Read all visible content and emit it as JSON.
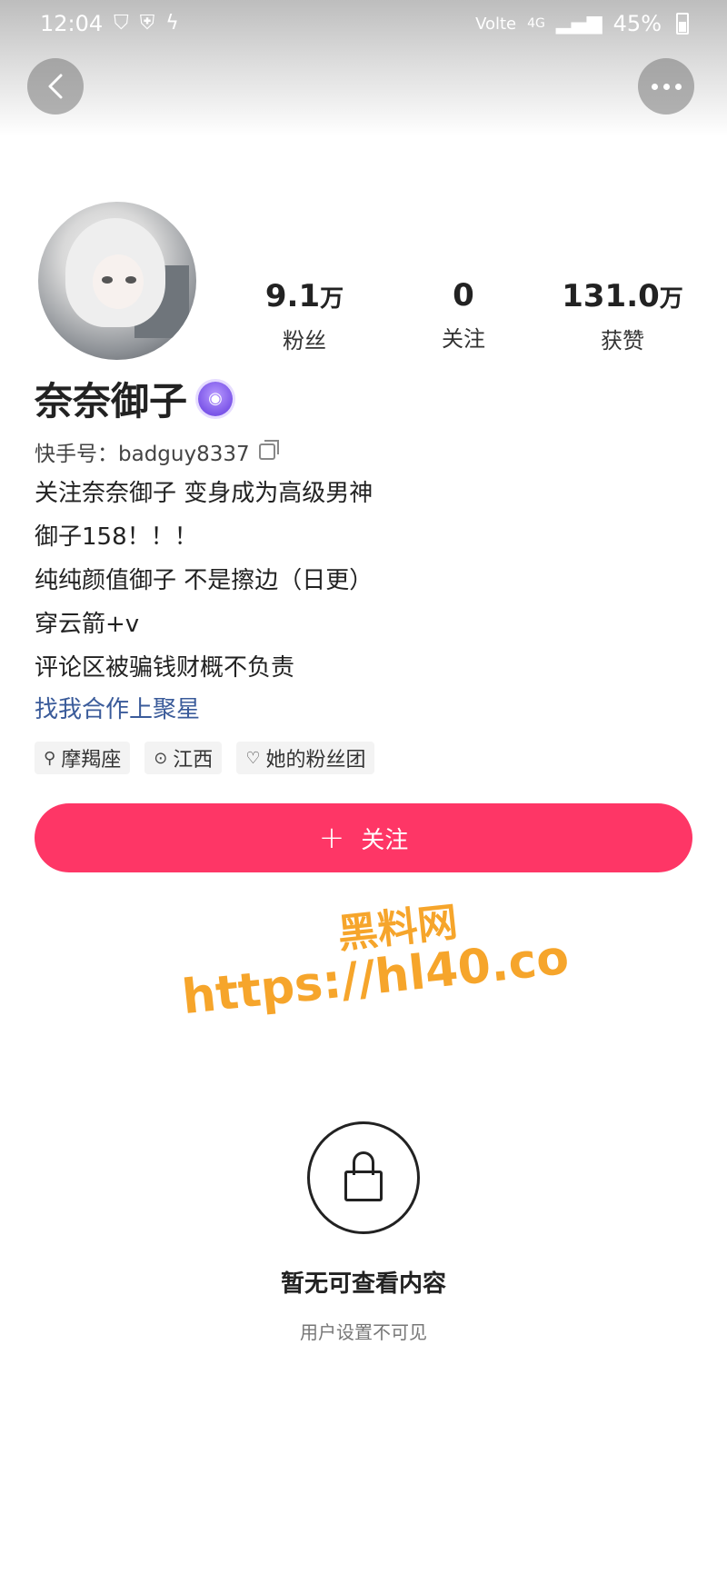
{
  "status_bar": {
    "time": "12:04",
    "left_icons": [
      "shield-check-icon",
      "shield-icon",
      "bolt-icon"
    ],
    "network": "Volte",
    "signal": "4G",
    "battery": "45%"
  },
  "nav": {
    "back_icon": "back-icon",
    "more_icon": "more-icon"
  },
  "profile": {
    "name": "奈奈御子",
    "badge_icon": "verified-badge-icon",
    "kuaishou_id": "快手号：badguy8337",
    "stats": [
      {
        "value": "9.1",
        "unit": "万",
        "label": "粉丝"
      },
      {
        "value": "0",
        "unit": "",
        "label": "关注"
      },
      {
        "value": "131.0",
        "unit": "万",
        "label": "获赞"
      }
    ],
    "bio": [
      "关注奈奈御子 变身成为高级男神",
      "御子158！！！",
      "纯纯颜值御子 不是擦边（日更）",
      "穿云箭+v",
      "评论区被骗钱财概不负责"
    ],
    "link": "找我合作上聚星",
    "tags": [
      {
        "icon": "zodiac-icon",
        "label": "摩羯座"
      },
      {
        "icon": "location-icon",
        "label": "江西"
      },
      {
        "icon": "heart-icon",
        "label": "她的粉丝团"
      }
    ]
  },
  "follow_button": {
    "label": "关注",
    "color": "#fe3666"
  },
  "watermark": {
    "title": "黑料网",
    "url": "https://hl40.co",
    "color": "#f6a52b"
  },
  "empty_state": {
    "icon": "lock-icon",
    "title": "暂无可查看内容",
    "subtitle": "用户设置不可见"
  }
}
